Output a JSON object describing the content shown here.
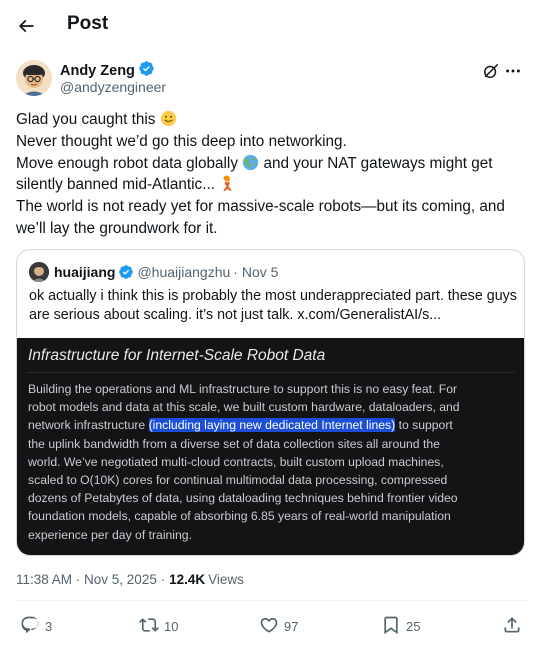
{
  "header": {
    "title": "Post"
  },
  "author": {
    "name": "Andy Zeng",
    "handle": "@andyzengineer"
  },
  "post": {
    "lines": [
      {
        "text": "Glad you caught this ",
        "emoji": "slightly-smiling-face"
      },
      {
        "text": "Never thought we’d go this deep into networking."
      },
      {
        "before": "Move enough robot data globally ",
        "emoji": "globe-americas",
        "after": " and your NAT gateways might get"
      },
      {
        "text": "silently banned mid-Atlantic... ",
        "emoji": "mermaid"
      },
      {
        "text": "The world is not ready yet for massive-scale robots—but its coming, and"
      },
      {
        "text": "we’ll lay the groundwork for it."
      }
    ]
  },
  "quote": {
    "name": "huaijiang",
    "handle": "@huaijiangzhu",
    "date": "· Nov 5",
    "lines": [
      "ok actually i think this is probably the most underappreciated part. these guys",
      "are serious about scaling. it’s not just talk.  x.com/GeneralistAI/s..."
    ],
    "media": {
      "title": "Infrastructure for Internet-Scale Robot Data",
      "lines": [
        "Building the operations and ML infrastructure to support this is no easy feat. For",
        "robot models and data at this scale, we built custom hardware, dataloaders, and",
        {
          "before": "network infrastructure ",
          "highlight": "(including laying new dedicated Internet lines)",
          "after": " to support"
        },
        "the uplink bandwidth from a diverse set of data collection sites all around the",
        "world. We’ve negotiated multi-cloud contracts, built custom upload machines,",
        "scaled to O(10K) cores for continual multimodal data processing, compressed",
        "dozens of Petabytes of data, using dataloading techniques behind frontier video",
        "foundation models, capable of absorbing 6.85 years of real-world manipulation",
        "experience per day of training."
      ]
    }
  },
  "meta": {
    "time_date": "11:38 AM · Nov 5, 2025 ·",
    "views_count": "12.4K",
    "views_label": "Views"
  },
  "actions": {
    "replies": "3",
    "reposts": "10",
    "likes": "97",
    "bookmarks": "25"
  },
  "colors": {
    "verified": "#1d9bf0",
    "secondary_text": "#536471",
    "media_bg": "#141416",
    "highlight": "#1d4ed8"
  }
}
